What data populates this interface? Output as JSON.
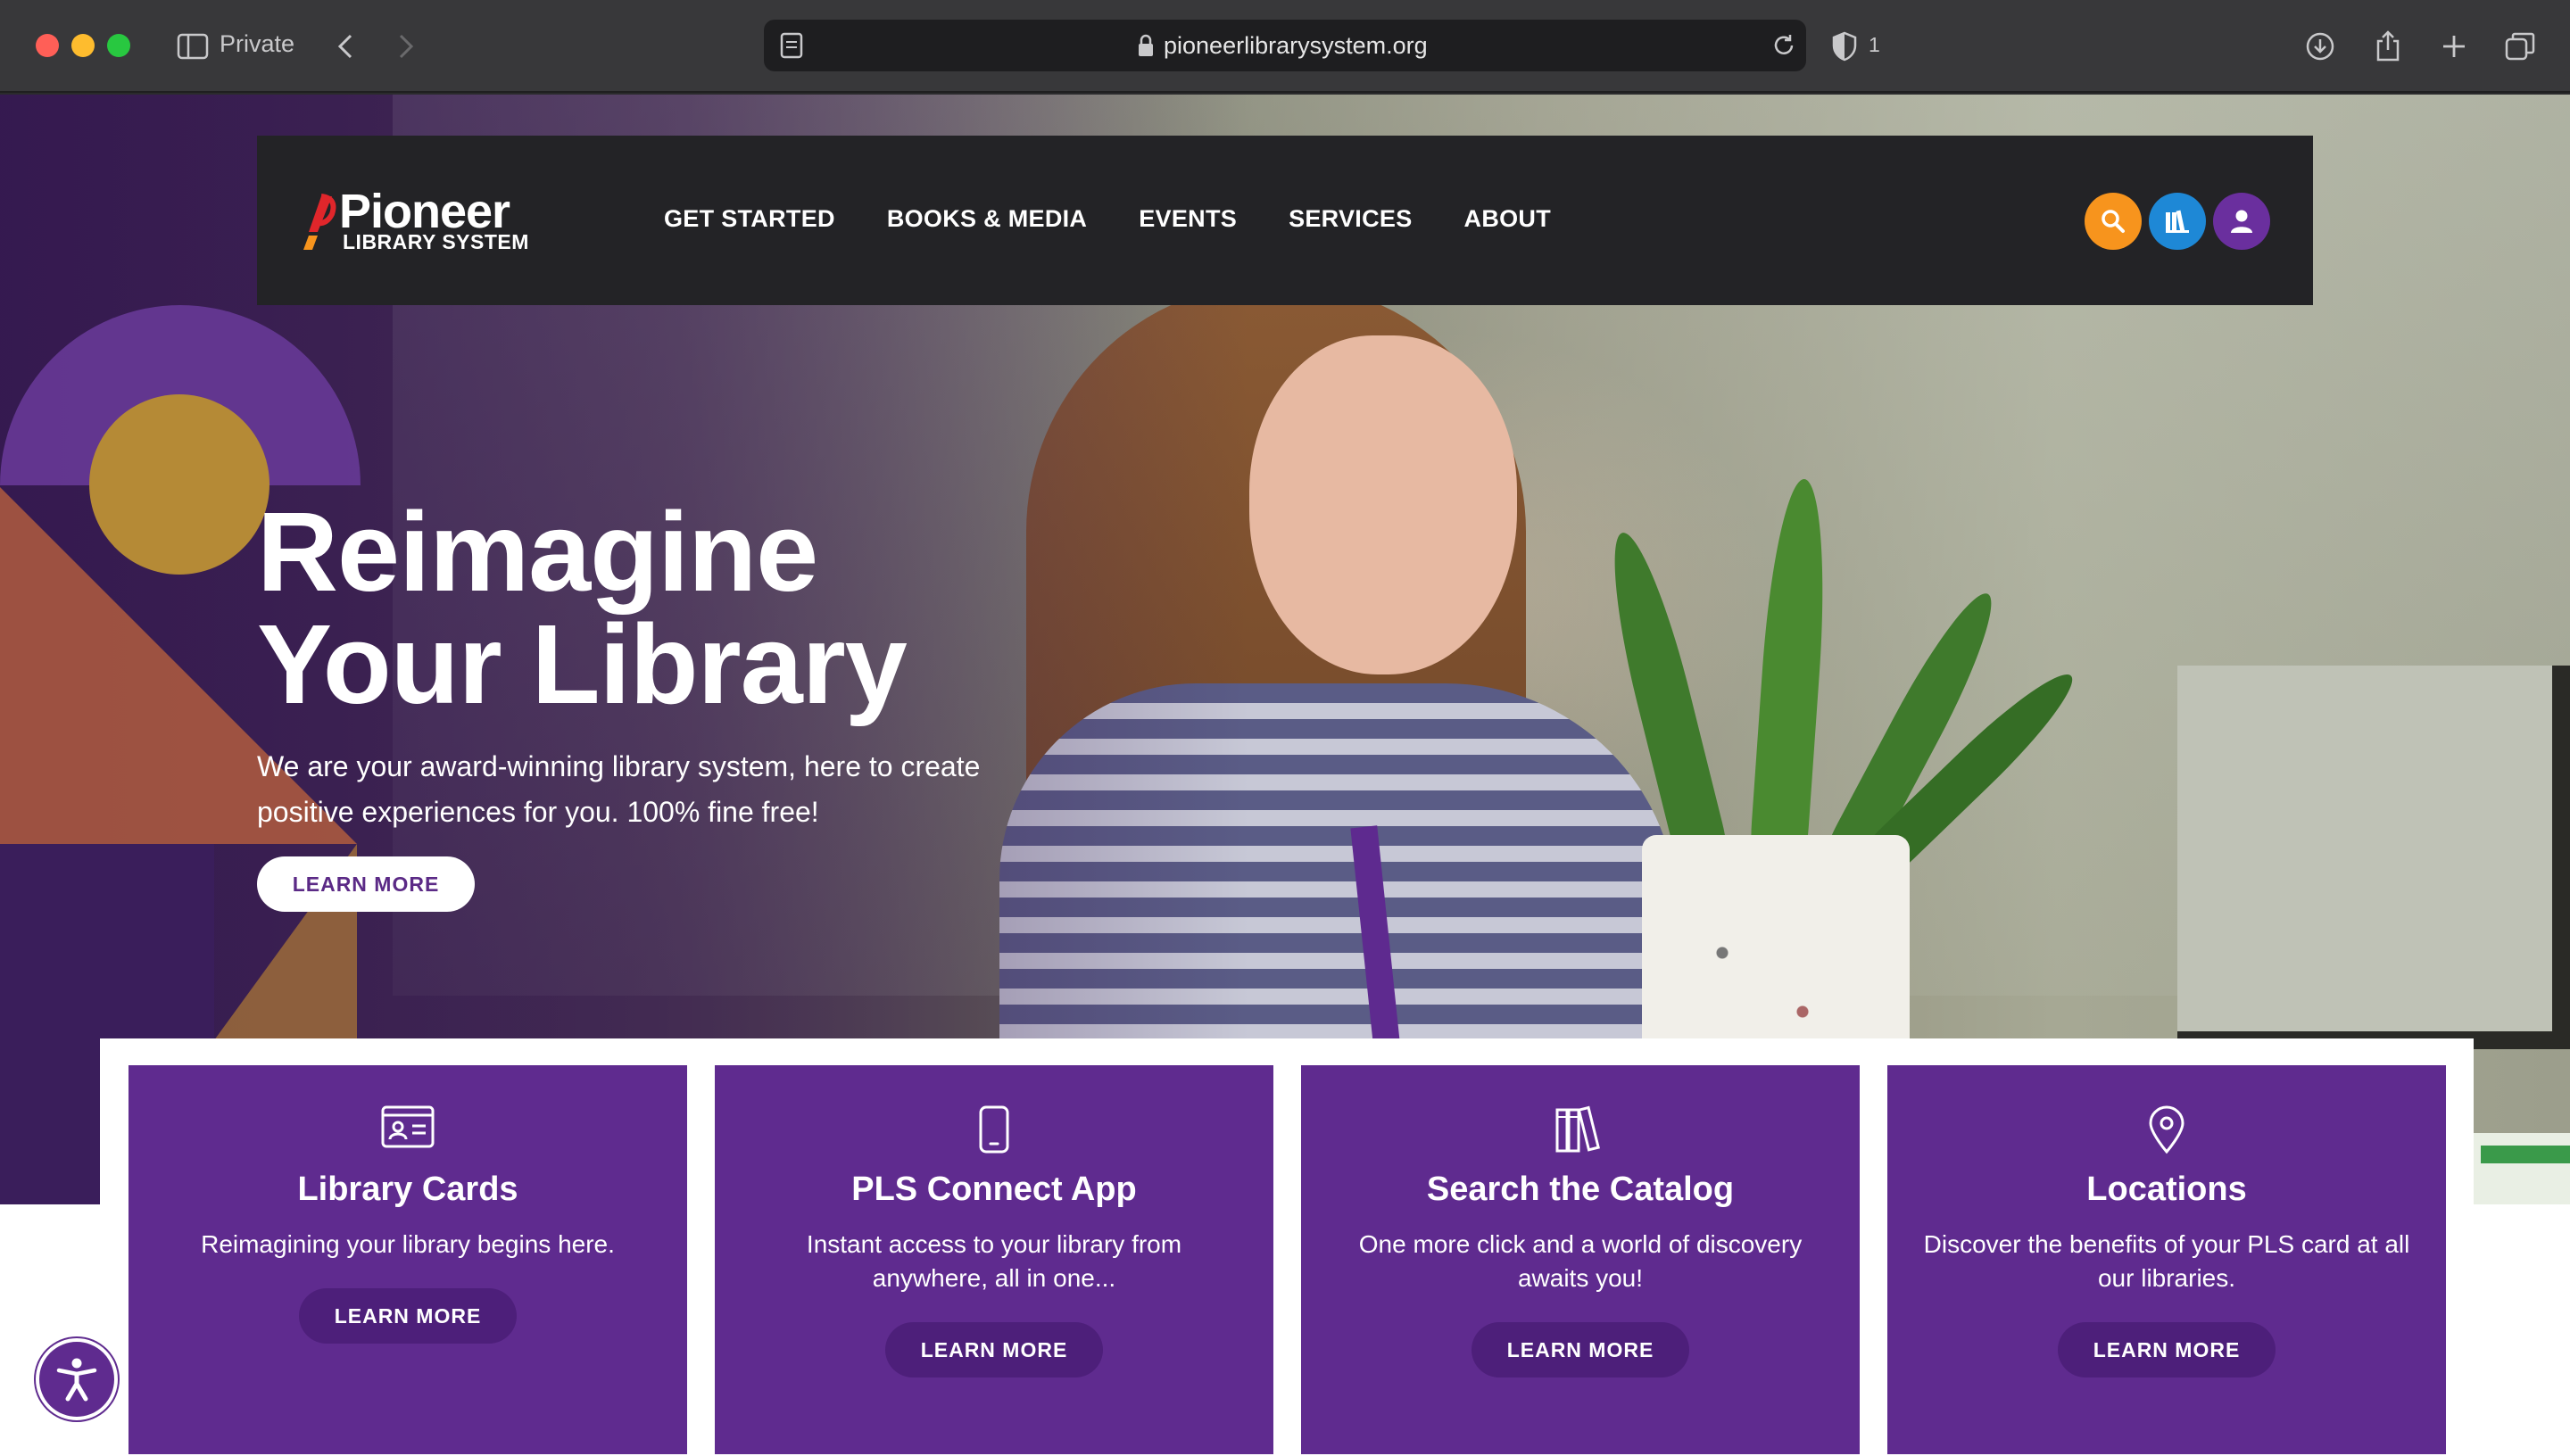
{
  "browser": {
    "private_label": "Private",
    "url": "pioneerlibrarysystem.org",
    "shield_count": "1"
  },
  "nav": {
    "logo_word": "Pioneer",
    "logo_sub": "LIBRARY SYSTEM",
    "links": [
      "GET STARTED",
      "BOOKS & MEDIA",
      "EVENTS",
      "SERVICES",
      "ABOUT"
    ],
    "colors": {
      "search": "#f7941d",
      "catalog": "#1e88d6",
      "account": "#6a2f9e"
    }
  },
  "hero": {
    "title_line1": "Reimagine",
    "title_line2": "Your Library",
    "subtitle": "We are your award-winning library system, here to create positive experiences for you. 100% fine free!",
    "button": "LEARN MORE"
  },
  "cards": [
    {
      "icon": "id-card-icon",
      "title": "Library Cards",
      "desc": "Reimagining your library begins here.",
      "button": "LEARN MORE"
    },
    {
      "icon": "phone-icon",
      "title": "PLS Connect App",
      "desc": "Instant access to your library from anywhere, all in one...",
      "button": "LEARN MORE"
    },
    {
      "icon": "books-icon",
      "title": "Search the Catalog",
      "desc": "One more click and a world of discovery awaits you!",
      "button": "LEARN MORE"
    },
    {
      "icon": "location-pin-icon",
      "title": "Locations",
      "desc": "Discover the benefits of your PLS card at all our libraries.",
      "button": "LEARN MORE"
    }
  ],
  "colors": {
    "brand_purple": "#5f2b8f",
    "nav_bg": "#232326"
  }
}
